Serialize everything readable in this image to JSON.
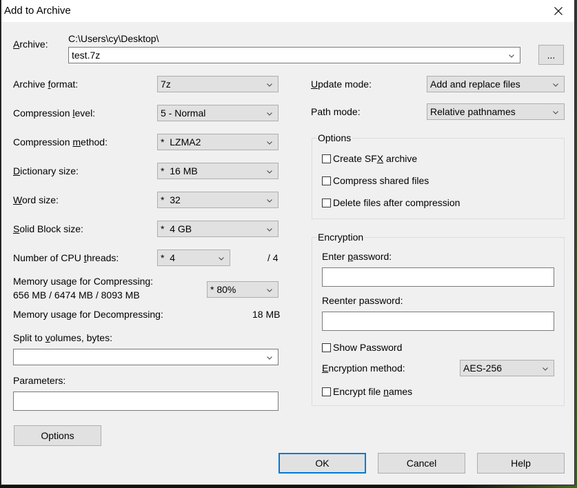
{
  "window": {
    "title": "Add to Archive",
    "close_icon": "close-icon"
  },
  "archive": {
    "label_pre": "",
    "label_accel": "A",
    "label_post": "rchive:",
    "path": "C:\\Users\\cy\\Desktop\\",
    "value": "test.7z",
    "browse_label": "..."
  },
  "left": {
    "archive_format": {
      "pre": "Archive ",
      "accel": "f",
      "post": "ormat:",
      "value": "7z"
    },
    "compression_level": {
      "pre": "Compression ",
      "accel": "l",
      "post": "evel:",
      "value": "5 - Normal"
    },
    "compression_method": {
      "pre": "Compression ",
      "accel": "m",
      "post": "ethod:",
      "value": "*  LZMA2"
    },
    "dictionary_size": {
      "pre": "",
      "accel": "D",
      "post": "ictionary size:",
      "value": "*  16 MB"
    },
    "word_size": {
      "pre": "",
      "accel": "W",
      "post": "ord size:",
      "value": "*  32"
    },
    "solid_block_size": {
      "pre": "",
      "accel": "S",
      "post": "olid Block size:",
      "value": "*  4 GB"
    },
    "cpu_threads": {
      "pre": "Number of CPU ",
      "accel": "t",
      "post": "hreads:",
      "value": "*  4",
      "max": "/ 4"
    },
    "memory_compress": {
      "label": "Memory usage for Compressing:",
      "detail": "656 MB / 6474 MB / 8093 MB",
      "value": "* 80%"
    },
    "memory_decompress": {
      "label": "Memory usage for Decompressing:",
      "value": "18 MB"
    },
    "split_volumes": {
      "pre": "Split to ",
      "accel": "v",
      "post": "olumes, bytes:",
      "value": ""
    },
    "parameters": {
      "label": "Parameters:",
      "value": ""
    },
    "options_button": "Options"
  },
  "right": {
    "update_mode": {
      "pre": "",
      "accel": "U",
      "post": "pdate mode:",
      "value": "Add and replace files"
    },
    "path_mode": {
      "label": "Path mode:",
      "value": "Relative pathnames"
    },
    "options_group": {
      "title": "Options",
      "checkboxes": [
        {
          "pre": "Create SF",
          "accel": "X",
          "post": " archive",
          "checked": false
        },
        {
          "pre": "Compress shared files",
          "accel": "",
          "post": "",
          "checked": false
        },
        {
          "pre": "Delete files after compression",
          "accel": "",
          "post": "",
          "checked": false
        }
      ]
    },
    "encryption_group": {
      "title": "Encryption",
      "enter_password": {
        "pre": "Enter ",
        "accel": "p",
        "post": "assword:",
        "value": ""
      },
      "reenter_password": {
        "label": "Reenter password:",
        "value": ""
      },
      "show_password": {
        "label": "Show Password",
        "checked": false
      },
      "encryption_method": {
        "pre": "",
        "accel": "E",
        "post": "ncryption method:",
        "value": "AES-256"
      },
      "encrypt_file_names": {
        "pre": "Encrypt file ",
        "accel": "n",
        "post": "ames",
        "checked": false
      }
    }
  },
  "buttons": {
    "ok": "OK",
    "cancel": "Cancel",
    "help": "Help"
  }
}
